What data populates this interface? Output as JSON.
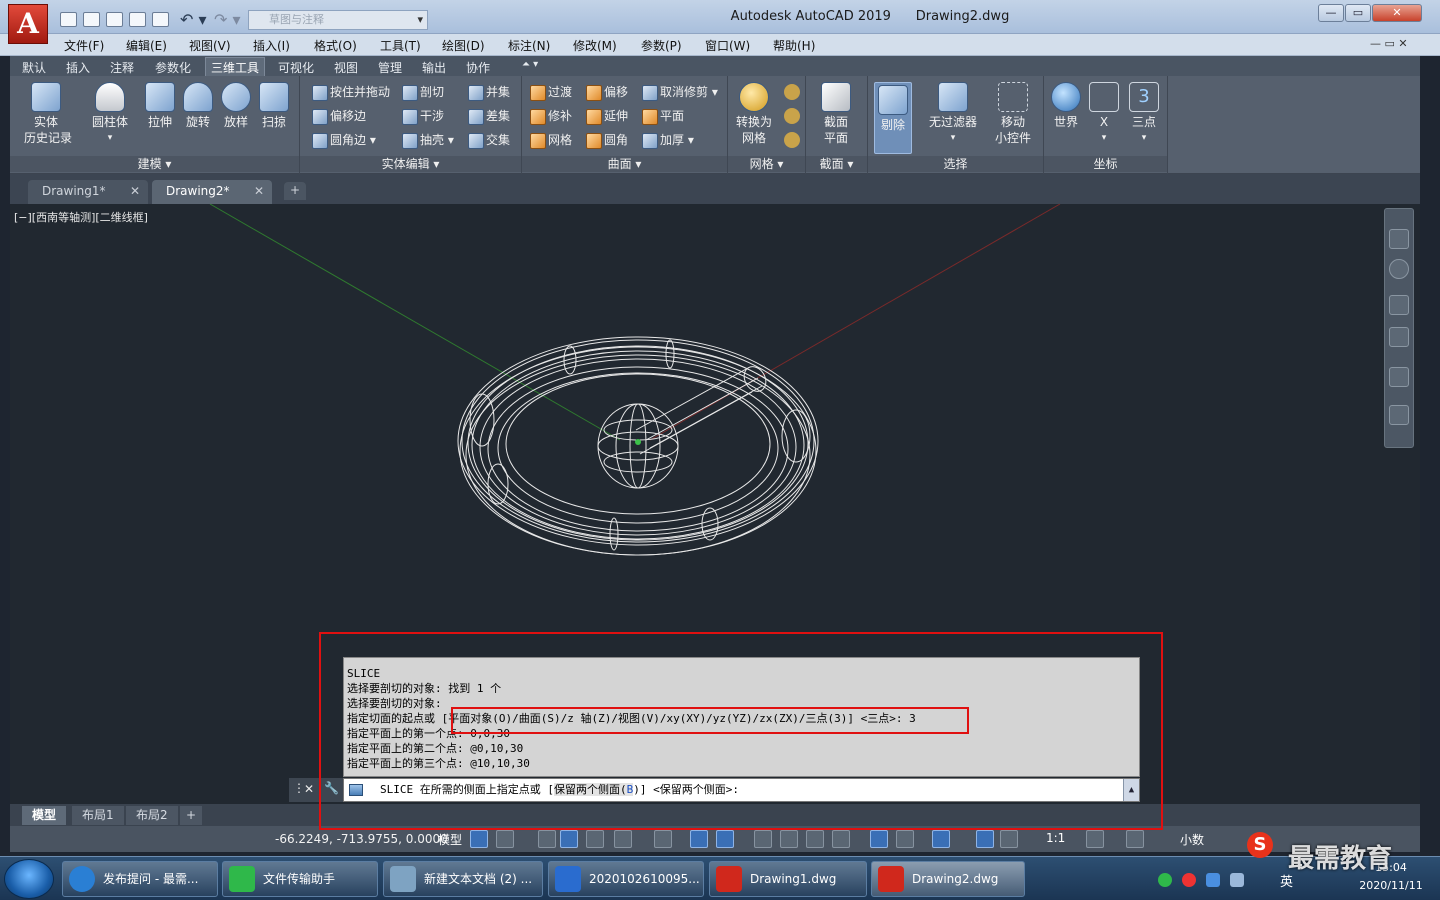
{
  "app": {
    "title": "Autodesk AutoCAD 2019",
    "document": "Drawing2.dwg",
    "logo": "A",
    "search_placeholder": "草图与注释"
  },
  "window_controls": {
    "minimize": "—",
    "restore": "▭",
    "close": "✕"
  },
  "menubar": [
    "文件(F)",
    "编辑(E)",
    "视图(V)",
    "插入(I)",
    "格式(O)",
    "工具(T)",
    "绘图(D)",
    "标注(N)",
    "修改(M)",
    "参数(P)",
    "窗口(W)",
    "帮助(H)"
  ],
  "ribbon_tabs": [
    "默认",
    "插入",
    "注释",
    "参数化",
    "三维工具",
    "可视化",
    "视图",
    "管理",
    "输出",
    "协作"
  ],
  "ribbon_active_tab": "三维工具",
  "ribbon_panels": {
    "modeling": {
      "title": "建模 ▾",
      "buttons": [
        "实体\n历史记录",
        "圆柱体",
        "拉伸",
        "旋转",
        "放样",
        "扫掠"
      ]
    },
    "solid_edit": {
      "title": "实体编辑 ▾",
      "buttons": [
        "按住并拖动",
        "偏移边",
        "圆角边 ▾",
        "剖切",
        "干涉",
        "抽壳 ▾",
        "并集",
        "差集",
        "交集"
      ]
    },
    "surface": {
      "title": "曲面 ▾",
      "buttons": [
        "过渡",
        "修补",
        "网格",
        "偏移",
        "延伸",
        "圆角",
        "取消修剪 ▾",
        "平面",
        "加厚 ▾"
      ]
    },
    "mesh": {
      "title": "网格 ▾",
      "buttons": [
        "转换为\n网格"
      ]
    },
    "section": {
      "title": "截面 ▾",
      "buttons": [
        "截面\n平面"
      ]
    },
    "selection": {
      "title": "选择",
      "buttons": [
        "剔除",
        "无过滤器",
        "移动\n小控件"
      ]
    },
    "coordinates": {
      "title": "坐标",
      "buttons": [
        "世界",
        "X",
        "三点"
      ]
    }
  },
  "doc_tabs": [
    {
      "label": "Drawing1*",
      "active": false
    },
    {
      "label": "Drawing2*",
      "active": true
    }
  ],
  "viewport": {
    "label": "[−][西南等轴测][二维线框]"
  },
  "command_history": [
    "SLICE",
    "选择要剖切的对象: 找到 1 个",
    "选择要剖切的对象:",
    "指定切面的起点或 [平面对象(O)/曲面(S)/z 轴(Z)/视图(V)/xy(XY)/yz(YZ)/zx(ZX)/三点(3)] <三点>: 3",
    "指定平面上的第一个点: 0,0,30",
    "指定平面上的第二个点: @0,10,30",
    "指定平面上的第三个点: @10,10,30"
  ],
  "command_line": {
    "prefix": "SLICE 在所需的侧面上指定点或 [",
    "option": "保留两个侧面(",
    "option_key": "B",
    "suffix": ")] <保留两个侧面>:"
  },
  "layout_tabs": [
    "模型",
    "布局1",
    "布局2",
    "+"
  ],
  "status": {
    "coords": "-66.2249, -713.9755, 0.0000",
    "model": "模型",
    "scale": "1:1",
    "units": "小数"
  },
  "taskbar": {
    "items": [
      {
        "label": "发布提问 - 最需...",
        "icon": "ie-icon",
        "color": "#2a7fd4"
      },
      {
        "label": "文件传输助手",
        "icon": "wechat-icon",
        "color": "#2fb84a"
      },
      {
        "label": "新建文本文档 (2) ...",
        "icon": "notepad-icon",
        "color": "#7ea3c2"
      },
      {
        "label": "2020102610095...",
        "icon": "word-icon",
        "color": "#2a6ccf"
      },
      {
        "label": "Drawing1.dwg",
        "icon": "autocad-icon",
        "color": "#d0281c"
      },
      {
        "label": "Drawing2.dwg",
        "icon": "autocad-icon",
        "color": "#d0281c"
      }
    ],
    "clock_time": "15:04",
    "clock_date": "2020/11/11",
    "ime": "英"
  },
  "watermark": "最需教育"
}
